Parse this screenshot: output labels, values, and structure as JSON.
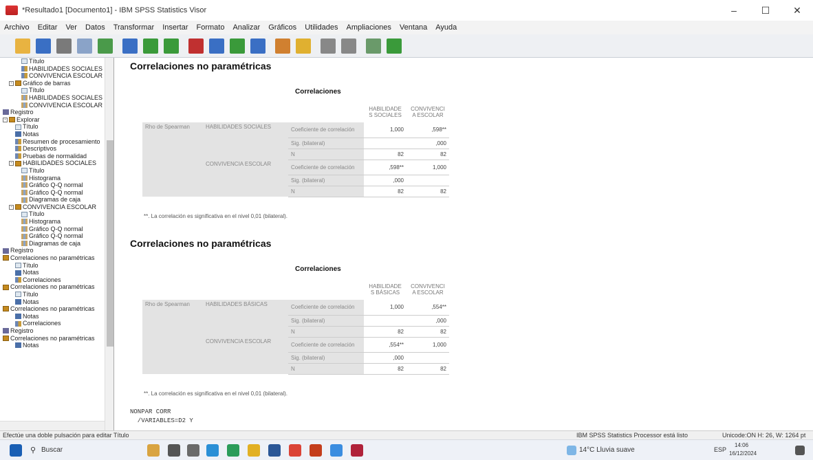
{
  "window": {
    "title": "*Resultado1 [Documento1] - IBM SPSS Statistics Visor",
    "minimize": "–",
    "maximize": "☐",
    "close": "✕"
  },
  "menu": [
    "Archivo",
    "Editar",
    "Ver",
    "Datos",
    "Transformar",
    "Insertar",
    "Formato",
    "Analizar",
    "Gráficos",
    "Utilidades",
    "Ampliaciones",
    "Ventana",
    "Ayuda"
  ],
  "toolbar_icons": [
    "open-icon",
    "save-icon",
    "print-icon",
    "preview-icon",
    "export-icon",
    "recall-dialog-icon",
    "undo-icon",
    "redo-icon",
    "goto-data-icon",
    "goto-variable-icon",
    "variables-icon",
    "case-icon",
    "insert-output-icon",
    "designate-window-icon",
    "hide-icon",
    "show-icon",
    "collapse-icon",
    "expand-icon"
  ],
  "tree": [
    {
      "label": "Título",
      "icon": "title",
      "indent": 3
    },
    {
      "label": "HABILIDADES SOCIALES",
      "icon": "table",
      "indent": 3
    },
    {
      "label": "CONVIVENCIA ESCOLAR",
      "icon": "table",
      "indent": 3
    },
    {
      "label": "Gráfico de barras",
      "icon": "book",
      "indent": 1,
      "exp": "-"
    },
    {
      "label": "Título",
      "icon": "title",
      "indent": 3
    },
    {
      "label": "HABILIDADES SOCIALES",
      "icon": "chart",
      "indent": 3
    },
    {
      "label": "CONVIVENCIA ESCOLAR",
      "icon": "chart",
      "indent": 3
    },
    {
      "label": "Registro",
      "icon": "log",
      "indent": 0
    },
    {
      "label": "Explorar",
      "icon": "book",
      "indent": 0,
      "exp": "-"
    },
    {
      "label": "Título",
      "icon": "title",
      "indent": 2
    },
    {
      "label": "Notas",
      "icon": "notes",
      "indent": 2
    },
    {
      "label": "Resumen de procesamiento",
      "icon": "table",
      "indent": 2
    },
    {
      "label": "Descriptivos",
      "icon": "table",
      "indent": 2
    },
    {
      "label": "Pruebas de normalidad",
      "icon": "table",
      "indent": 2
    },
    {
      "label": "HABILIDADES SOCIALES",
      "icon": "book",
      "indent": 1,
      "exp": "-"
    },
    {
      "label": "Título",
      "icon": "title",
      "indent": 3
    },
    {
      "label": "Histograma",
      "icon": "chart",
      "indent": 3
    },
    {
      "label": "Gráfico Q-Q normal",
      "icon": "chart",
      "indent": 3
    },
    {
      "label": "Gráfico Q-Q normal",
      "icon": "chart",
      "indent": 3
    },
    {
      "label": "Diagramas de caja",
      "icon": "chart",
      "indent": 3
    },
    {
      "label": "CONVIVENCIA ESCOLAR",
      "icon": "book",
      "indent": 1,
      "exp": "-"
    },
    {
      "label": "Título",
      "icon": "title",
      "indent": 3
    },
    {
      "label": "Histograma",
      "icon": "chart",
      "indent": 3
    },
    {
      "label": "Gráfico Q-Q normal",
      "icon": "chart",
      "indent": 3
    },
    {
      "label": "Gráfico Q-Q normal",
      "icon": "chart",
      "indent": 3
    },
    {
      "label": "Diagramas de caja",
      "icon": "chart",
      "indent": 3
    },
    {
      "label": "Registro",
      "icon": "log",
      "indent": 0
    },
    {
      "label": "Correlaciones no paramétricas",
      "icon": "book",
      "indent": 0
    },
    {
      "label": "Título",
      "icon": "title",
      "indent": 2
    },
    {
      "label": "Notas",
      "icon": "notes",
      "indent": 2
    },
    {
      "label": "Correlaciones",
      "icon": "table",
      "indent": 2
    },
    {
      "label": "Correlaciones no paramétricas",
      "icon": "book",
      "indent": 0
    },
    {
      "label": "Título",
      "icon": "title",
      "indent": 2
    },
    {
      "label": "Notas",
      "icon": "notes",
      "indent": 2
    },
    {
      "label": "Correlaciones no paramétricas",
      "icon": "book",
      "indent": 0
    },
    {
      "label": "Notas",
      "icon": "notes",
      "indent": 2
    },
    {
      "label": "Correlaciones",
      "icon": "table",
      "indent": 2
    },
    {
      "label": "Registro",
      "icon": "log",
      "indent": 0
    },
    {
      "label": "Correlaciones no paramétricas",
      "icon": "book",
      "indent": 0
    },
    {
      "label": "Notas",
      "icon": "notes",
      "indent": 2
    }
  ],
  "blocks": [
    {
      "heading": "Correlaciones no paramétricas",
      "caption": "Correlaciones",
      "col1": "HABILIDADE S SOCIALES",
      "col2": "CONVIVENCI A ESCOLAR",
      "rho": "Rho de Spearman",
      "var1": "HABILIDADES SOCIALES",
      "var2": "CONVIVENCIA ESCOLAR",
      "stat_coef": "Coeficiente de correlación",
      "stat_sig": "Sig. (bilateral)",
      "stat_n": "N",
      "r1": [
        "1,000",
        ",598**"
      ],
      "r2": [
        "",
        ",000"
      ],
      "r3": [
        "82",
        "82"
      ],
      "r4": [
        ",598**",
        "1,000"
      ],
      "r5": [
        ",000",
        ""
      ],
      "r6": [
        "82",
        "82"
      ],
      "note": "**. La correlación es significativa en el nivel 0,01 (bilateral)."
    },
    {
      "heading": "Correlaciones no paramétricas",
      "caption": "Correlaciones",
      "col1": "HABILIDADE S BÁSICAS",
      "col2": "CONVIVENCI A ESCOLAR",
      "rho": "Rho de Spearman",
      "var1": "HABILIDADES BÁSICAS",
      "var2": "CONVIVENCIA ESCOLAR",
      "stat_coef": "Coeficiente de correlación",
      "stat_sig": "Sig. (bilateral)",
      "stat_n": "N",
      "r1": [
        "1,000",
        ",554**"
      ],
      "r2": [
        "",
        ",000"
      ],
      "r3": [
        "82",
        "82"
      ],
      "r4": [
        ",554**",
        "1,000"
      ],
      "r5": [
        ",000",
        ""
      ],
      "r6": [
        "82",
        "82"
      ],
      "note": "**. La correlación es significativa en el nivel 0,01 (bilateral)."
    }
  ],
  "syntax": [
    "NONPAR CORR",
    "  /VARIABLES=D2 Y"
  ],
  "status": {
    "hint": "Efectúe una doble pulsación para editar Título",
    "processor": "IBM SPSS Statistics Processor está listo",
    "unicode": "Unicode:ON  H: 26, W: 1264 pt"
  },
  "taskbar": {
    "search": "Buscar",
    "weather": "14°C  Lluvia suave",
    "lang": "ESP",
    "time": "14:06",
    "date": "16/12/2024"
  }
}
